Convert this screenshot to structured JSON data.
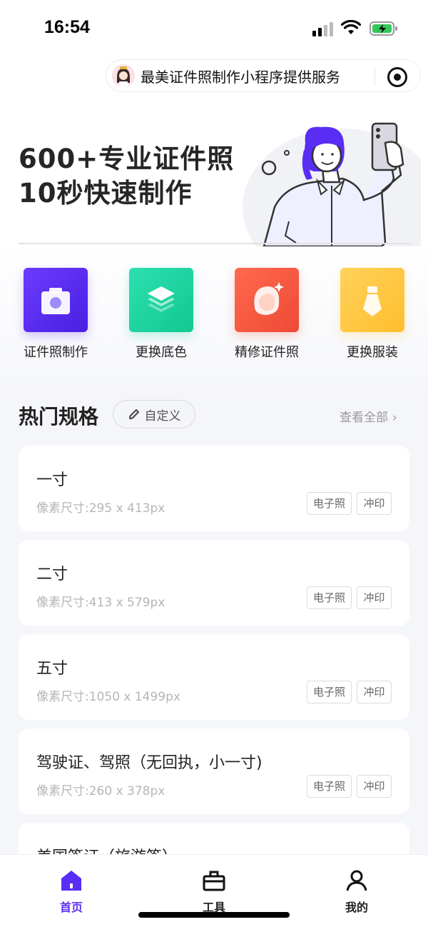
{
  "status": {
    "time": "16:54"
  },
  "capsule": {
    "text": "最美证件照制作小程序提供服务"
  },
  "banner": {
    "line1": "600+专业证件照",
    "line2": "10秒快速制作"
  },
  "features": [
    {
      "label": "证件照制作",
      "icon": "camera-icon",
      "color": "#5a2df4"
    },
    {
      "label": "更换底色",
      "icon": "layers-icon",
      "color": "#16d3a0"
    },
    {
      "label": "精修证件照",
      "icon": "face-retouch-icon",
      "color": "#f2563f"
    },
    {
      "label": "更换服装",
      "icon": "tie-icon",
      "color": "#ffc93d"
    }
  ],
  "section": {
    "title": "热门规格",
    "custom_label": "自定义",
    "see_all": "查看全部"
  },
  "specs": [
    {
      "name": "一寸",
      "size": "像素尺寸:295 x 413px",
      "tag_e": "电子照",
      "tag_p": "冲印"
    },
    {
      "name": "二寸",
      "size": "像素尺寸:413 x 579px",
      "tag_e": "电子照",
      "tag_p": "冲印"
    },
    {
      "name": "五寸",
      "size": "像素尺寸:1050 x 1499px",
      "tag_e": "电子照",
      "tag_p": "冲印"
    },
    {
      "name": "驾驶证、驾照（无回执，小一寸)",
      "size": "像素尺寸:260 x 378px",
      "tag_e": "电子照",
      "tag_p": "冲印"
    },
    {
      "name": "美国签证（旅游签）"
    }
  ],
  "tabs": [
    {
      "label": "首页",
      "icon": "home-icon",
      "active": true
    },
    {
      "label": "工具",
      "icon": "toolbox-icon"
    },
    {
      "label": "我的",
      "icon": "user-icon"
    }
  ],
  "colors": {
    "accent": "#5a2df4",
    "text": "#222222",
    "muted": "#b5b5b5"
  }
}
